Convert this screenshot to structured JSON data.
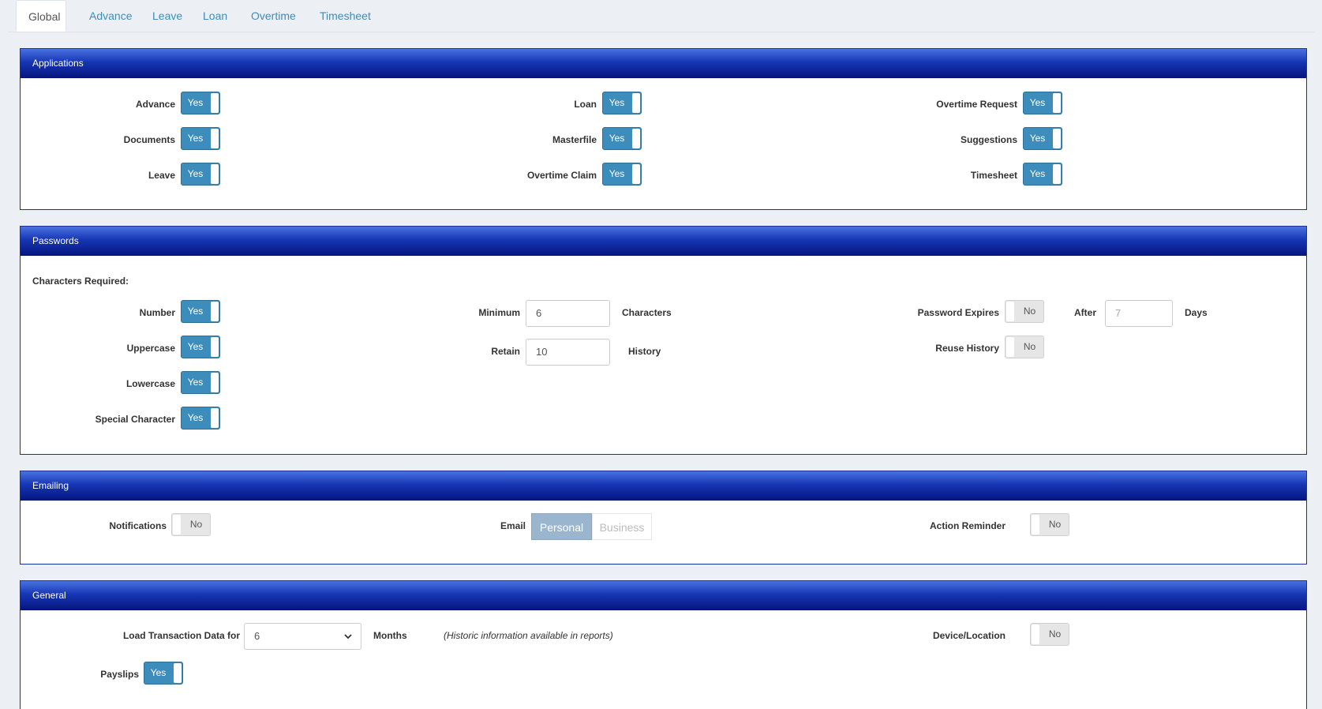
{
  "tabs": [
    {
      "label": "Global",
      "active": true
    },
    {
      "label": "Advance"
    },
    {
      "label": "Leave"
    },
    {
      "label": "Loan"
    },
    {
      "label": "Overtime"
    },
    {
      "label": "Timesheet"
    }
  ],
  "colors": {
    "header_gradient": [
      "#4a72e0",
      "#06157e"
    ],
    "toggle_on": "#3c8dbc",
    "toggle_off": "#e6e6e6"
  },
  "applications": {
    "title": "Applications",
    "items": [
      {
        "label": "Advance",
        "value": "Yes"
      },
      {
        "label": "Documents",
        "value": "Yes"
      },
      {
        "label": "Leave",
        "value": "Yes"
      },
      {
        "label": "Loan",
        "value": "Yes"
      },
      {
        "label": "Masterfile",
        "value": "Yes"
      },
      {
        "label": "Overtime Claim",
        "value": "Yes"
      },
      {
        "label": "Overtime Request",
        "value": "Yes"
      },
      {
        "label": "Suggestions",
        "value": "Yes"
      },
      {
        "label": "Timesheet",
        "value": "Yes"
      }
    ]
  },
  "passwords": {
    "title": "Passwords",
    "characters_required": "Characters Required:",
    "number": {
      "label": "Number",
      "value": "Yes"
    },
    "uppercase": {
      "label": "Uppercase",
      "value": "Yes"
    },
    "lowercase": {
      "label": "Lowercase",
      "value": "Yes"
    },
    "special": {
      "label": "Special Character",
      "value": "Yes"
    },
    "minimum": {
      "label": "Minimum",
      "value": "6",
      "suffix": "Characters"
    },
    "retain": {
      "label": "Retain",
      "value": "10",
      "suffix": "History"
    },
    "expires": {
      "label": "Password Expires",
      "value": "No",
      "after_label": "After",
      "after_placeholder": "7",
      "days_label": "Days"
    },
    "reuse": {
      "label": "Reuse History",
      "value": "No"
    }
  },
  "emailing": {
    "title": "Emailing",
    "notifications": {
      "label": "Notifications",
      "value": "No"
    },
    "email": {
      "label": "Email",
      "options": [
        "Personal",
        "Business"
      ],
      "selected": "Personal"
    },
    "action_reminder": {
      "label": "Action Reminder",
      "value": "No"
    }
  },
  "general": {
    "title": "General",
    "load": {
      "label": "Load Transaction Data for",
      "value": "6",
      "suffix": "Months",
      "note": "(Historic information available in reports)"
    },
    "device": {
      "label": "Device/Location",
      "value": "No"
    },
    "payslips": {
      "label": "Payslips",
      "value": "Yes"
    }
  }
}
